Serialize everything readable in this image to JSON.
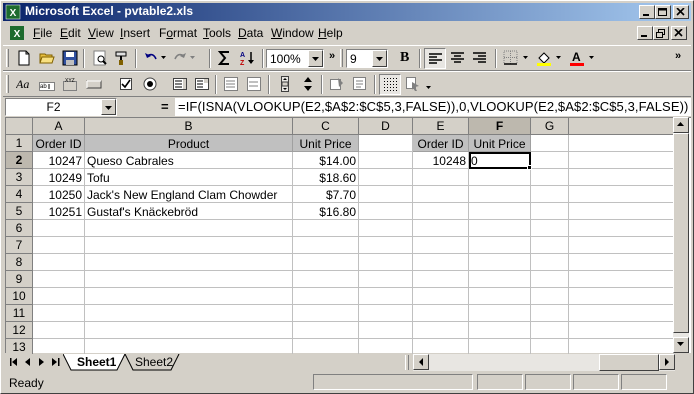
{
  "window": {
    "title": "Microsoft Excel - pvtable2.xls"
  },
  "menu": [
    {
      "label": "File",
      "u": "F",
      "rest": "ile"
    },
    {
      "label": "Edit",
      "u": "E",
      "rest": "dit"
    },
    {
      "label": "View",
      "u": "V",
      "rest": "iew"
    },
    {
      "label": "Insert",
      "u": "I",
      "rest": "nsert"
    },
    {
      "label": "Format",
      "u": "o",
      "pre": "F",
      "rest": "rmat"
    },
    {
      "label": "Tools",
      "u": "T",
      "rest": "ools"
    },
    {
      "label": "Data",
      "u": "D",
      "rest": "ata"
    },
    {
      "label": "Window",
      "u": "W",
      "rest": "indow"
    },
    {
      "label": "Help",
      "u": "H",
      "rest": "elp"
    }
  ],
  "toolbar": {
    "zoom": "100%",
    "font_size": "9",
    "bold_label": "B"
  },
  "formula_bar": {
    "name_box": "F2",
    "eq": "=",
    "formula": "=IF(ISNA(VLOOKUP(E2,$A$2:$C$5,3,FALSE)),0,VLOOKUP(E2,$A$2:$C$5,3,FALSE))"
  },
  "columns": [
    "A",
    "B",
    "C",
    "D",
    "E",
    "F",
    "G"
  ],
  "active_column": "F",
  "active_row": 2,
  "rows": [
    1,
    2,
    3,
    4,
    5,
    6,
    7,
    8,
    9,
    10,
    11,
    12,
    13
  ],
  "cells": {
    "A1": "Order ID",
    "B1": "Product",
    "C1": "Unit Price",
    "E1": "Order ID",
    "F1": "Unit Price",
    "A2": "10247",
    "B2": "Queso Cabrales",
    "C2": "$14.00",
    "E2": "10248",
    "F2": "0",
    "A3": "10249",
    "B3": "Tofu",
    "C3": "$18.60",
    "A4": "10250",
    "B4": "Jack's New England Clam Chowder",
    "C4": "$7.70",
    "A5": "10251",
    "B5": "Gustaf's Knäckebröd",
    "C5": "$16.80"
  },
  "sheets": [
    "Sheet1",
    "Sheet2"
  ],
  "active_sheet": "Sheet1",
  "status": {
    "text": "Ready"
  }
}
